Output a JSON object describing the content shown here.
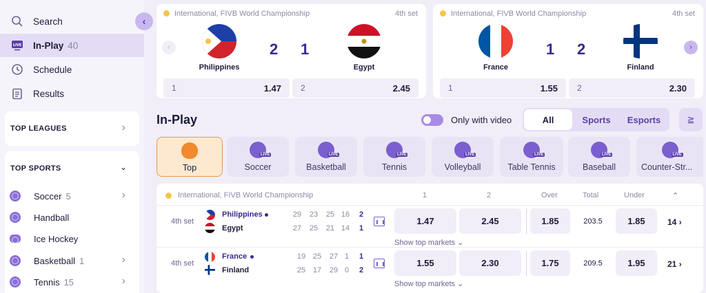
{
  "sidebar": {
    "nav": [
      {
        "label": "Search",
        "icon": "search-icon"
      },
      {
        "label": "In-Play",
        "count": "40",
        "icon": "live-tv-icon"
      },
      {
        "label": "Schedule",
        "icon": "clock-icon"
      },
      {
        "label": "Results",
        "icon": "clipboard-icon"
      }
    ],
    "top_leagues": "TOP LEAGUES",
    "top_sports": "TOP SPORTS",
    "sports": [
      {
        "label": "Soccer",
        "count": "5"
      },
      {
        "label": "Handball",
        "count": ""
      },
      {
        "label": "Ice Hockey",
        "count": ""
      },
      {
        "label": "Basketball",
        "count": "1"
      },
      {
        "label": "Tennis",
        "count": "15"
      }
    ]
  },
  "cards": [
    {
      "league": "International, FIVB World Championship",
      "set": "4th set",
      "team1": "Philippines",
      "team2": "Egypt",
      "score1": "2",
      "score2": "1",
      "odd1_key": "1",
      "odd1": "1.47",
      "odd2_key": "2",
      "odd2": "2.45"
    },
    {
      "league": "International, FIVB World Championship",
      "set": "4th set",
      "team1": "France",
      "team2": "Finland",
      "score1": "1",
      "score2": "2",
      "odd1_key": "1",
      "odd1": "1.55",
      "odd2_key": "2",
      "odd2": "2.30"
    }
  ],
  "inplay": {
    "title": "In-Play",
    "video_label": "Only with video",
    "segments": [
      "All",
      "Sports",
      "Esports"
    ]
  },
  "sport_tabs": [
    "Top",
    "Soccer",
    "Basketball",
    "Tennis",
    "Volleyball",
    "Table Tennis",
    "Baseball",
    "Counter-Str..."
  ],
  "table": {
    "league": "International, FIVB World Championship",
    "headers": {
      "c1": "1",
      "c2": "2",
      "over": "Over",
      "total": "Total",
      "under": "Under"
    },
    "show_markets": "Show top markets",
    "rows": [
      {
        "set": "4th set",
        "team1": "Philippines",
        "team2": "Egypt",
        "sets1": [
          "29",
          "23",
          "25",
          "16"
        ],
        "sets2": [
          "27",
          "25",
          "21",
          "14"
        ],
        "pts1": "2",
        "pts2": "1",
        "odd1": "1.47",
        "odd2": "2.45",
        "over": "1.85",
        "total": "203.5",
        "under": "1.85",
        "more": "14"
      },
      {
        "set": "4th set",
        "team1": "France",
        "team2": "Finland",
        "sets1": [
          "19",
          "25",
          "27",
          "1"
        ],
        "sets2": [
          "25",
          "17",
          "29",
          "0"
        ],
        "pts1": "1",
        "pts2": "2",
        "odd1": "1.55",
        "odd2": "2.30",
        "over": "1.75",
        "total": "209.5",
        "under": "1.95",
        "more": "21"
      }
    ]
  },
  "colors": {
    "accent": "#7b5fcf",
    "active_bg": "#e4dcf5",
    "score": "#3a2a8a",
    "top_tab": "#fde9cf"
  }
}
